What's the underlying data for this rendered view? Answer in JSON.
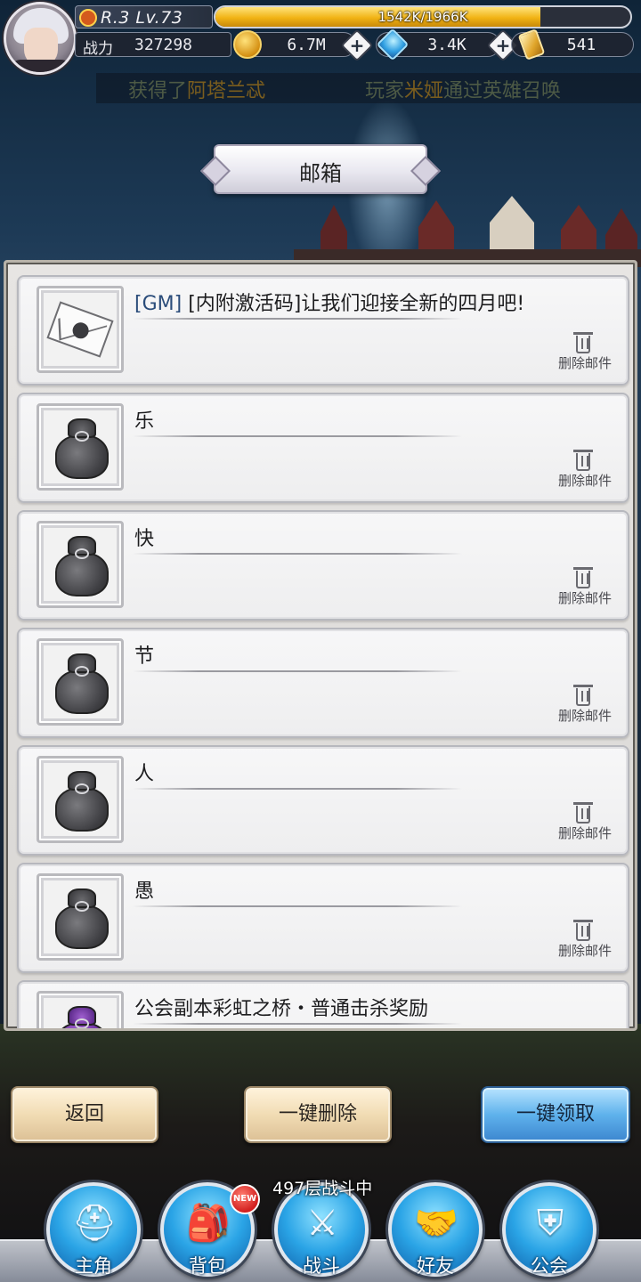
{
  "player": {
    "rank_level": "R.3 Lv.73",
    "exp_text": "1542K/1966K",
    "exp_fraction": 0.784,
    "power_label": "战力",
    "power_value": "327298"
  },
  "currencies": {
    "gold": "6.7M",
    "gems": "3.4K",
    "tickets": "541"
  },
  "ticker": {
    "msg1_prefix": "获得了",
    "msg1_highlight": "阿塔兰忒",
    "msg2_prefix": "玩家",
    "msg2_highlight": "米娅",
    "msg2_suffix": "通过英雄召唤"
  },
  "title": "邮箱",
  "mails": [
    {
      "tag": "[GM]",
      "title": " [内附激活码]让我们迎接全新的四月吧!",
      "icon": "envelope-icon",
      "delete_label": "删除邮件"
    },
    {
      "tag": "",
      "title": "乐",
      "icon": "pouch-icon",
      "delete_label": "删除邮件"
    },
    {
      "tag": "",
      "title": "快",
      "icon": "pouch-icon",
      "delete_label": "删除邮件"
    },
    {
      "tag": "",
      "title": "节",
      "icon": "pouch-icon",
      "delete_label": "删除邮件"
    },
    {
      "tag": "",
      "title": "人",
      "icon": "pouch-icon",
      "delete_label": "删除邮件"
    },
    {
      "tag": "",
      "title": "愚",
      "icon": "pouch-icon",
      "delete_label": "删除邮件"
    },
    {
      "tag": "",
      "title": "公会副本彩虹之桥・普通击杀奖励",
      "icon": "purple-pouch-icon",
      "delete_label": ""
    }
  ],
  "actions": {
    "back": "返回",
    "delete_all": "一键删除",
    "claim_all": "一键领取"
  },
  "nav": {
    "battle_status": "497层战斗中",
    "new_badge": "NEW",
    "items": [
      {
        "label": "主角",
        "icon": "hero-helmet-icon"
      },
      {
        "label": "背包",
        "icon": "backpack-icon"
      },
      {
        "label": "战斗",
        "icon": "crossed-swords-icon"
      },
      {
        "label": "好友",
        "icon": "handshake-icon"
      },
      {
        "label": "公会",
        "icon": "guild-crest-icon"
      }
    ]
  },
  "colors": {
    "exp_fill": "#f1b314",
    "primary_button": "#5fb2ec",
    "secondary_button": "#f1dcb4",
    "ticker_highlight": "#7a5d1e",
    "gm_tag": "#2a4c7a"
  }
}
